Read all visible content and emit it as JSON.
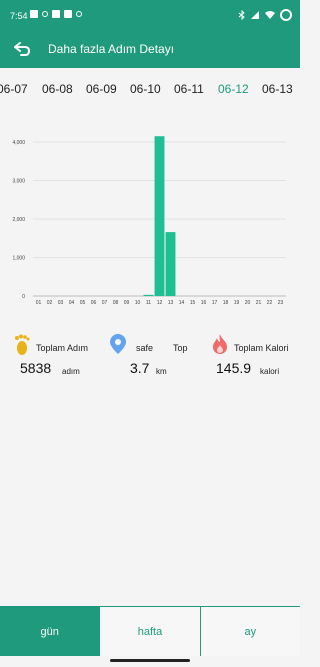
{
  "status": {
    "time": "7:54"
  },
  "appbar": {
    "title": "Daha fazla Adım Detayı"
  },
  "dates": [
    "06-07",
    "06-08",
    "06-09",
    "06-10",
    "06-11",
    "06-12",
    "06-13"
  ],
  "selected_date": "06-12",
  "chart_data": {
    "type": "bar",
    "categories": [
      "01",
      "02",
      "03",
      "04",
      "05",
      "06",
      "07",
      "08",
      "09",
      "10",
      "11",
      "12",
      "13",
      "14",
      "15",
      "16",
      "17",
      "18",
      "19",
      "20",
      "21",
      "22",
      "23"
    ],
    "values": [
      0,
      0,
      0,
      0,
      0,
      0,
      0,
      0,
      0,
      0,
      30,
      4150,
      1660,
      0,
      0,
      0,
      0,
      0,
      0,
      0,
      0,
      0,
      0
    ],
    "ylim": [
      0,
      4000
    ],
    "yticks": [
      "0",
      "1,000",
      "2,000",
      "3,000",
      "4,000"
    ],
    "grid": true,
    "colors": {
      "bar": "#1fbf94",
      "grid": "#e2e2e2"
    }
  },
  "stats": {
    "steps": {
      "label": "Toplam Adım",
      "value": "5838",
      "unit": "adım"
    },
    "distance": {
      "label_a": "safe",
      "label_b": "Top",
      "value": "3.7",
      "unit": "km"
    },
    "calories": {
      "label": "Toplam Kalori",
      "value": "145.9",
      "unit": "kalori"
    }
  },
  "tabs": [
    {
      "label": "gün",
      "active": true
    },
    {
      "label": "hafta",
      "active": false
    },
    {
      "label": "ay",
      "active": false
    }
  ],
  "icons": {
    "back": "back-arrow-icon",
    "steps": "footprint-icon",
    "distance": "location-pin-icon",
    "calories": "flame-icon"
  },
  "colors": {
    "primary": "#1f9a7c",
    "bar": "#1fbf94",
    "steps_icon": "#e8b21a",
    "pin_icon": "#63a3f0",
    "flame_icon": "#f06a6a"
  }
}
